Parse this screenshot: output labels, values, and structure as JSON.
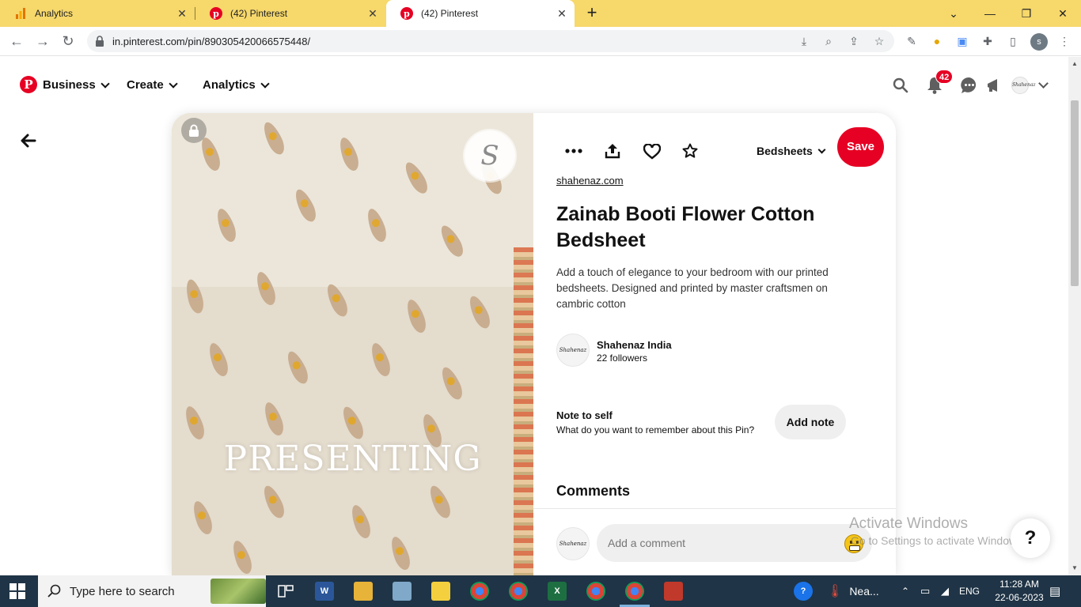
{
  "browser": {
    "tabs": [
      {
        "title": "Analytics",
        "icon": "analytics-icon"
      },
      {
        "title": "(42) Pinterest",
        "icon": "pinterest-icon"
      },
      {
        "title": "(42) Pinterest",
        "icon": "pinterest-icon"
      }
    ],
    "url": "in.pinterest.com/pin/890305420066575448/",
    "profile_initial": "s"
  },
  "header": {
    "nav": [
      "Business",
      "Create",
      "Analytics"
    ],
    "notification_count": "42",
    "avatar_text": "Shahenaz"
  },
  "pin": {
    "image_text": "PRESENTING",
    "brand_mark": "S",
    "board": "Bedsheets",
    "save_label": "Save",
    "source": "shahenaz.com",
    "title": "Zainab Booti Flower Cotton Bedsheet",
    "description": "Add a touch of elegance to your bedroom with our printed bedsheets. Designed and printed by master craftsmen on cambric cotton",
    "creator": {
      "name": "Shahenaz India",
      "followers": "22 followers",
      "avatar_text": "Shahenaz"
    },
    "note": {
      "title": "Note to self",
      "subtitle": "What do you want to remember about this Pin?",
      "button": "Add note"
    },
    "comments": {
      "heading": "Comments",
      "placeholder": "Add a comment"
    }
  },
  "watermark": {
    "line1": "Activate Windows",
    "line2": "Go to Settings to activate Windows."
  },
  "help_label": "?",
  "taskbar": {
    "search_placeholder": "Type here to search",
    "weather": "Nea...",
    "language": "ENG",
    "time": "11:28 AM",
    "date": "22-06-2023"
  },
  "colors": {
    "pinterest_red": "#e60023",
    "tab_bar": "#f6d86b",
    "taskbar": "#1f3446"
  }
}
